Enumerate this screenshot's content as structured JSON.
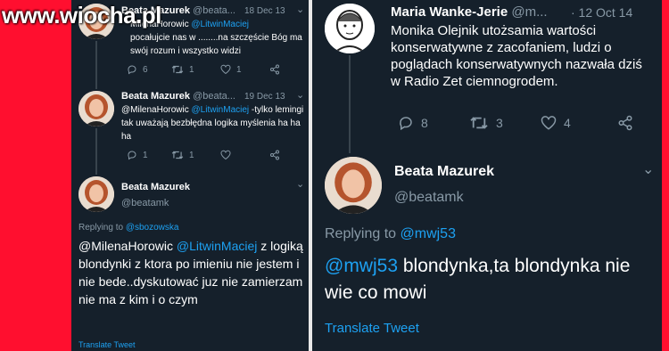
{
  "watermark": "www.wiocha.pl",
  "left": {
    "tweet1": {
      "name": "Beata Mazurek",
      "handle": "@beata...",
      "date": "18 Dec 13",
      "text_pre": "MilenaHorowic ",
      "mention": "@LitwinMaciej",
      "text_post": "pocałujcie nas w ........na szczęście Bóg ma swój rozum i wszystko widzi",
      "replies": "6",
      "retweets": "1",
      "likes": "1"
    },
    "tweet2": {
      "name": "Beata Mazurek",
      "handle": "@beata...",
      "date": "19 Dec 13",
      "text_pre": "@MilenaHorowic ",
      "mention": "@LitwinMaciej",
      "text_post": " -tylko lemingi tak uważają bezbłędna logika myślenia ha ha ha",
      "replies": "1",
      "retweets": "1",
      "likes": ""
    },
    "main": {
      "name": "Beata Mazurek",
      "handle": "@beatamk",
      "replying_label": "Replying to ",
      "replying_to": "@sbozowska",
      "text_pre": "@MilenaHorowic ",
      "mention": "@LitwinMaciej",
      "text_post": " z logiką blondynki z ktora po imieniu nie jestem i nie bede..dyskutować juz nie zamierzam nie ma z kim i o czym",
      "translate": "Translate Tweet"
    }
  },
  "right": {
    "tweet1": {
      "name": "Maria Wanke-Jerie",
      "handle": "@m...",
      "date": "· 12 Oct 14",
      "text": "Monika Olejnik utożsamia wartości konserwatywne z zacofaniem, ludzi o poglądach konserwatywnych nazwała dziś w Radio Zet ciemnogrodem.",
      "replies": "8",
      "retweets": "3",
      "likes": "4"
    },
    "main": {
      "name": "Beata Mazurek",
      "handle": "@beatamk",
      "replying_label": "Replying to ",
      "replying_to": "@mwj53",
      "mention": "@mwj53",
      "text_post": " blondynka,ta blondynka nie wie co mowi",
      "translate": "Translate Tweet"
    }
  },
  "colors": {
    "background": "#15202b",
    "link": "#1da1f2",
    "muted": "#8899a6",
    "frame": "#ff0f2f"
  }
}
